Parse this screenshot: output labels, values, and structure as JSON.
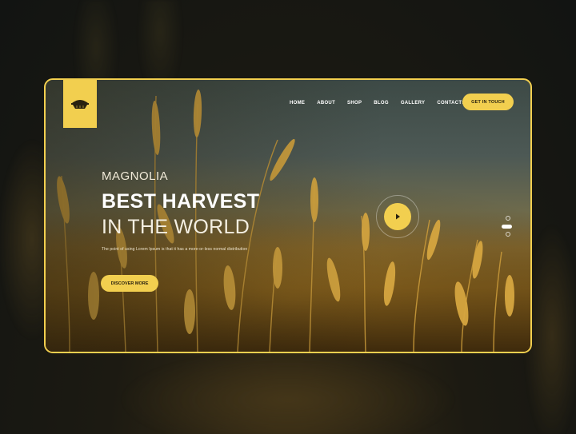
{
  "nav": {
    "items": [
      "HOME",
      "ABOUT",
      "SHOP",
      "BLOG",
      "GALLERY",
      "CONTACTS"
    ],
    "cta_label": "GET IN TOUCH"
  },
  "hero": {
    "subtitle": "MAGNOLIA",
    "title_bold": "BEST HARVEST",
    "title_light": "IN THE WORLD",
    "description": "The point of using Lorem Ipsum is that it has a more-or-less normal distribution",
    "button_label": "DISCOVER MORE"
  },
  "slider": {
    "count": 3,
    "active_index": 1
  },
  "icons": {
    "logo": "basket-logo-icon",
    "play": "play-icon"
  },
  "colors": {
    "accent": "#f2cf4f",
    "text_dark": "#2a2210",
    "text_light": "#ffffff"
  }
}
